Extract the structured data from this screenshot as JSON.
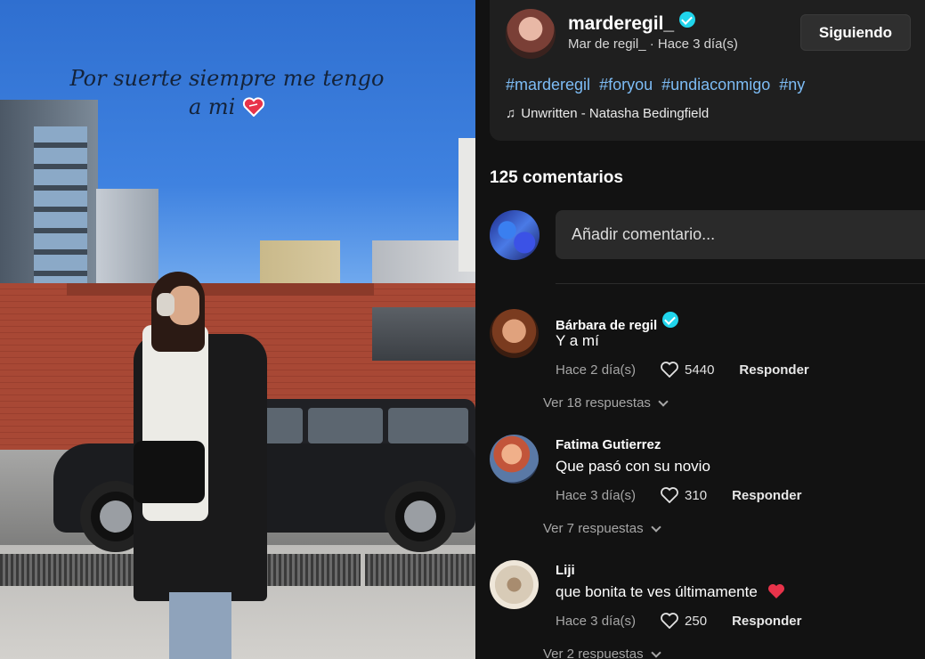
{
  "video": {
    "caption": "Por suerte siempre me tengo a mi",
    "caption_emoji": "heart-emoji"
  },
  "post": {
    "username": "marderegil_",
    "display_name": "Mar de regil_",
    "time_ago": "Hace 3 día(s)",
    "follow_label": "Siguiendo",
    "hashtags": [
      "#marderegil",
      "#foryou",
      "#undiaconmigo",
      "#ny"
    ],
    "music": "Unwritten - Natasha Bedingfield"
  },
  "comments_section": {
    "count_label": "125 comentarios",
    "input_placeholder": "Añadir comentario...",
    "comments": [
      {
        "user": "Bárbara de regil",
        "verified": true,
        "text": "Y a mí",
        "time": "Hace 2 día(s)",
        "likes": "5440",
        "reply_label": "Responder",
        "more_replies": "Ver 18 respuestas"
      },
      {
        "user": "Fatima Gutierrez",
        "verified": false,
        "text": "Que pasó con su novio",
        "time": "Hace 3 día(s)",
        "likes": "310",
        "reply_label": "Responder",
        "more_replies": "Ver 7 respuestas"
      },
      {
        "user": "Liji",
        "verified": false,
        "text": "que bonita te ves últimamente",
        "time": "Hace 3 día(s)",
        "likes": "250",
        "reply_label": "Responder",
        "more_replies": "Ver 2 respuestas"
      }
    ]
  },
  "colors": {
    "background": "#121212",
    "card": "#1f1f1f",
    "hashtag": "#7dbcf5",
    "verified": "#20d5ec",
    "emoji_heart": "#e8334a"
  }
}
